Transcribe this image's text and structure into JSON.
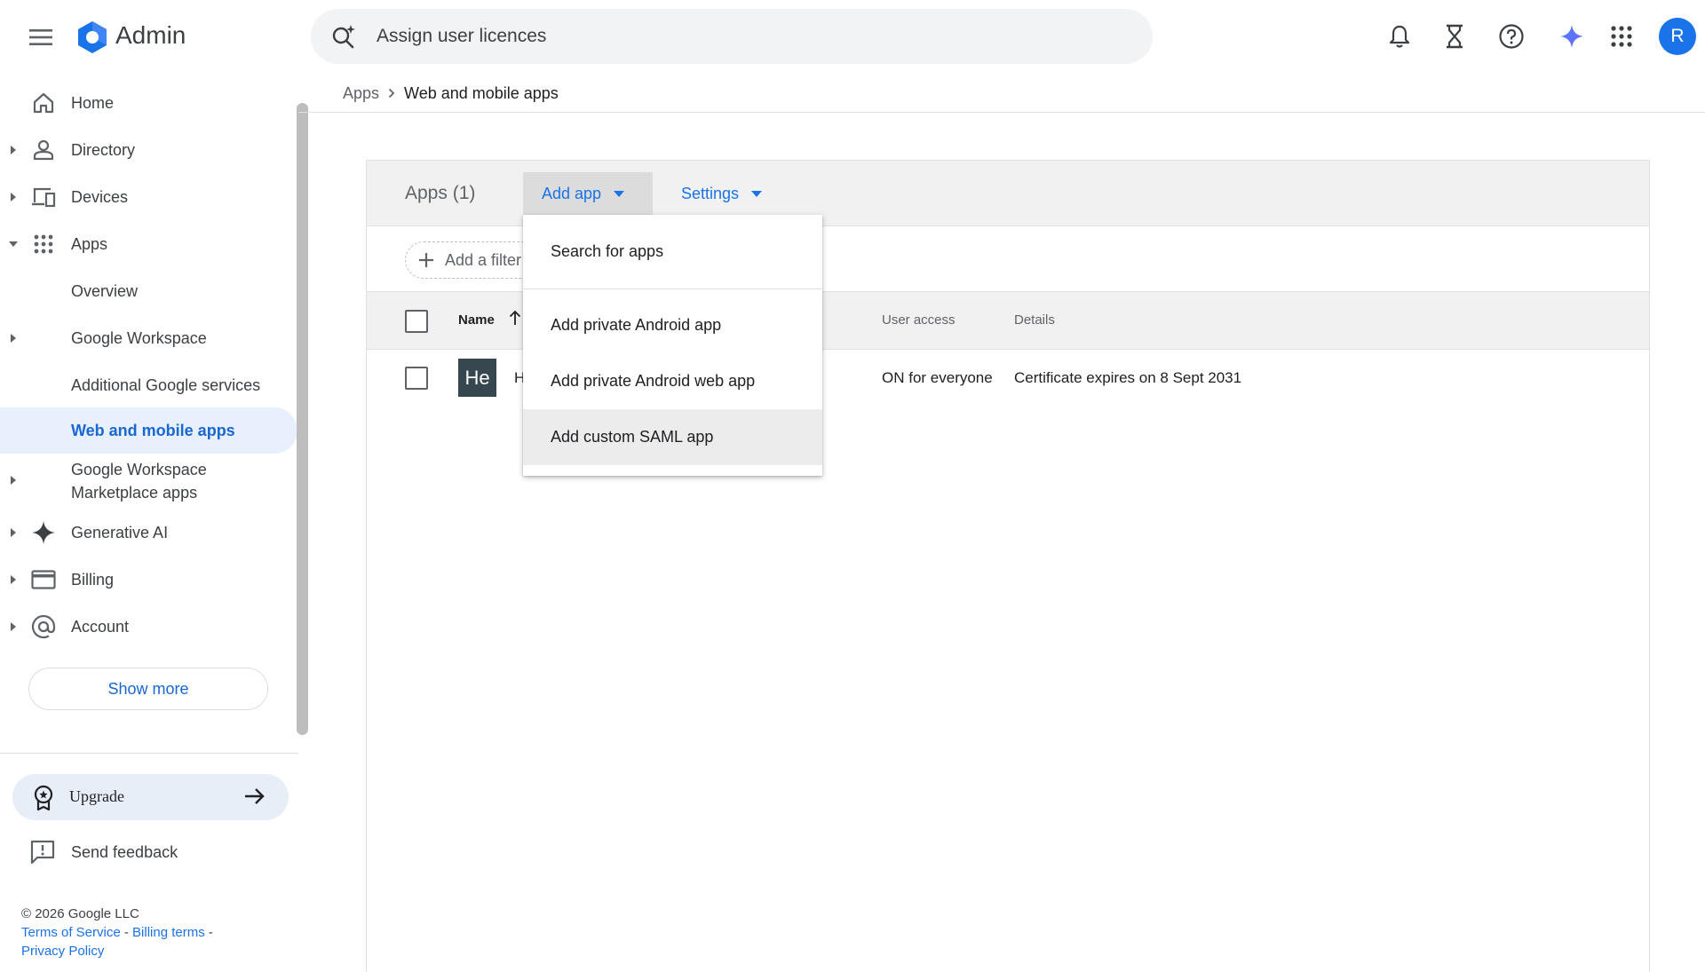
{
  "header": {
    "brand": "Admin",
    "search_text": "Assign user licences",
    "avatar_letter": "R"
  },
  "sidebar": {
    "items": [
      {
        "label": "Home"
      },
      {
        "label": "Directory"
      },
      {
        "label": "Devices"
      },
      {
        "label": "Apps"
      },
      {
        "label": "Overview"
      },
      {
        "label": "Google Workspace"
      },
      {
        "label": "Additional Google services"
      },
      {
        "label": "Web and mobile apps"
      },
      {
        "label": "Google Workspace Marketplace apps"
      },
      {
        "label": "Generative AI"
      },
      {
        "label": "Billing"
      },
      {
        "label": "Account"
      }
    ],
    "show_more": "Show more",
    "upgrade": "Upgrade",
    "send_feedback": "Send feedback",
    "footer": {
      "copyright": "© 2026 Google LLC",
      "terms": "Terms of Service",
      "sep1": " - ",
      "billing_terms": "Billing terms",
      "sep2": " -",
      "privacy": "Privacy Policy"
    }
  },
  "breadcrumb": {
    "parent": "Apps",
    "current": "Web and mobile apps"
  },
  "card": {
    "title": "Apps (1)",
    "add_app": "Add app",
    "settings": "Settings",
    "filter": "Add a filter"
  },
  "table": {
    "columns": {
      "name": "Name",
      "user_access": "User access",
      "details": "Details"
    },
    "rows": [
      {
        "tile": "He",
        "name": "H",
        "user_access": "ON for everyone",
        "details": "Certificate expires on 8 Sept 2031"
      }
    ]
  },
  "dropdown": {
    "items": [
      {
        "label": "Search for apps"
      },
      {
        "label": "Add private Android app"
      },
      {
        "label": "Add private Android web app"
      },
      {
        "label": "Add custom SAML app"
      }
    ]
  },
  "colors": {
    "accent": "#1a73e8",
    "active_nav_bg": "#e8f0fe"
  }
}
